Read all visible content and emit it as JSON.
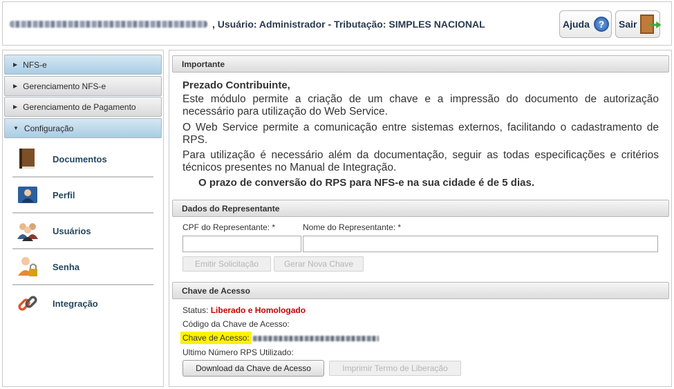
{
  "header": {
    "user_line": ", Usuário: Administrador - Tributação: SIMPLES NACIONAL",
    "help_label": "Ajuda",
    "help_glyph": "?",
    "exit_label": "Sair"
  },
  "sidebar": {
    "sections": [
      {
        "label": "NFS-e",
        "state": "collapsed"
      },
      {
        "label": "Gerenciamento NFS-e",
        "state": "collapsed"
      },
      {
        "label": "Gerenciamento de Pagamento",
        "state": "collapsed"
      },
      {
        "label": "Configuração",
        "state": "expanded"
      }
    ],
    "items": [
      {
        "label": "Documentos",
        "icon": "book-icon"
      },
      {
        "label": "Perfil",
        "icon": "profile-icon"
      },
      {
        "label": "Usuários",
        "icon": "users-icon"
      },
      {
        "label": "Senha",
        "icon": "password-icon"
      },
      {
        "label": "Integração",
        "icon": "link-icon"
      }
    ]
  },
  "important": {
    "title": "Importante",
    "greeting": "Prezado Contribuinte,",
    "paragraphs": [
      "Este módulo permite a criação de um chave e a impressão do documento de autorização necessário para utilização do Web Service.",
      "O Web Service permite a comunicação entre sistemas externos, facilitando o cadastramento de RPS.",
      "Para utilização é necessário além da documentação, seguir as todas especificações e critérios técnicos presentes no Manual de Integração."
    ],
    "notice": "O prazo de conversão do RPS para NFS-e na sua cidade é de 5 dias."
  },
  "representative": {
    "title": "Dados do Representante",
    "cpf_label": "CPF do Representante: *",
    "cpf_value": "",
    "name_label": "Nome do Representante: *",
    "name_value": "",
    "request_button": "Emitir Solicitação",
    "new_key_button": "Gerar Nova Chave"
  },
  "access_key": {
    "title": "Chave de Acesso",
    "status_label": "Status:",
    "status_value": "Liberado e Homologado",
    "code_label": "Código da Chave de Acesso:",
    "key_label": "Chave de Acesso:",
    "last_rps_label": "Ultimo Número RPS Utilizado:",
    "download_button": "Download da Chave de Acesso",
    "print_button": "Imprimir Termo de Liberação"
  },
  "colors": {
    "accordion_blue": "#a9cde4",
    "status_red": "#c40000",
    "highlight_yellow": "#fff200",
    "menu_text": "#24475f"
  }
}
